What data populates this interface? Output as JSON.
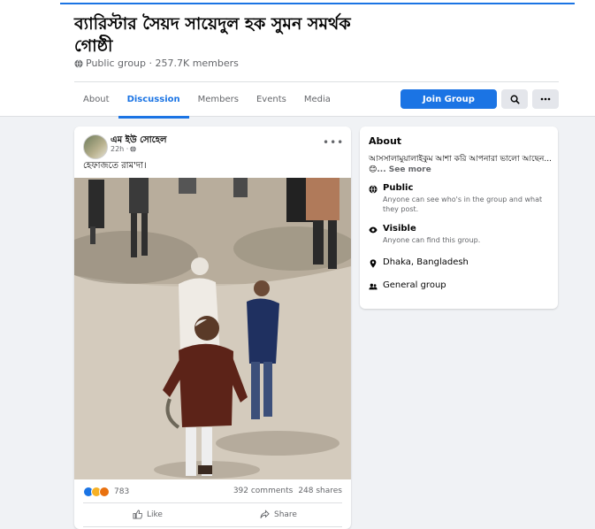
{
  "group": {
    "title": "ব্যারিস্টার সৈয়দ সায়েদুল হক সুমন সমর্থক গোষ্ঠী",
    "meta": "Public group · 257.7K members"
  },
  "tabs": [
    "About",
    "Discussion",
    "Members",
    "Events",
    "Media"
  ],
  "actions": {
    "join_label": "Join Group"
  },
  "post": {
    "author": "এম ইউ সোহেল",
    "time": "22h ·",
    "text": "হেফাজতে রাম'দা।",
    "reaction_count": "783",
    "comments": "392 comments",
    "shares": "248 shares",
    "like_label": "Like",
    "share_label": "Share"
  },
  "about": {
    "title": "About",
    "description": "আসসালামুয়ালাইকুম আশা করি আপনারা ভালো আছেন...😊",
    "see_more": "... See more",
    "public_title": "Public",
    "public_desc": "Anyone can see who's in the group and what they post.",
    "visible_title": "Visible",
    "visible_desc": "Anyone can find this group.",
    "location": "Dhaka, Bangladesh",
    "category": "General group"
  },
  "colors": {
    "accent": "#1b74e4",
    "background": "#f0f2f5",
    "secondary_text": "#65676b"
  }
}
